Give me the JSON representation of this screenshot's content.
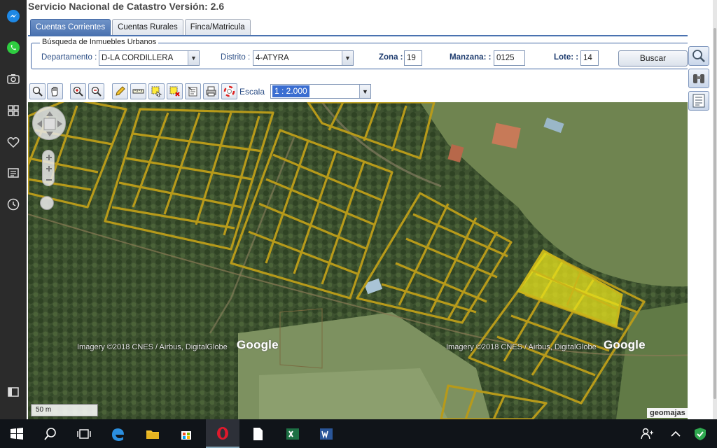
{
  "app": {
    "title": "Servicio Nacional de Catastro Versión: 2.6"
  },
  "tabs": [
    {
      "label": "Cuentas Corrientes",
      "active": true
    },
    {
      "label": "Cuentas Rurales",
      "active": false
    },
    {
      "label": "Finca/Matricula",
      "active": false
    }
  ],
  "search": {
    "legend": "Búsqueda de Inmuebles Urbanos",
    "departamento_label": "Departamento :",
    "departamento_value": "D-LA CORDILLERA",
    "distrito_label": "Distrito :",
    "distrito_value": "4-ATYRA",
    "zona_label": "Zona :",
    "zona_value": "19",
    "manzana_label": "Manzana: :",
    "manzana_value": "0125",
    "lote_label": "Lote: :",
    "lote_value": "14",
    "buscar_label": "Buscar"
  },
  "toolbar": {
    "scale_label": "Escala",
    "scale_value": "1 : 2.000"
  },
  "map": {
    "attribution_left": "Imagery ©2018 CNES / Airbus, DigitalGlobe",
    "attribution_right": "Imagery ©2018 CNES / Airbus, DigitalGlobe",
    "google_left": "Google",
    "google_right": "Google",
    "scale_bar": "50 m",
    "brand": "geomajas",
    "parcel_color": "#b79a1a",
    "selected_color": "#e7e21c"
  },
  "dock_icons": [
    "messenger-icon",
    "whatsapp-icon",
    "camera-icon",
    "apps-icon",
    "heart-icon",
    "news-icon",
    "clock-icon",
    "sidebar-toggle-icon"
  ],
  "taskbar_icons": [
    "windows-start-icon",
    "search-icon",
    "task-view-icon",
    "edge-icon",
    "file-explorer-icon",
    "store-icon",
    "opera-icon",
    "notepad-icon",
    "excel-icon",
    "word-icon"
  ],
  "tray_icons": [
    "people-icon",
    "chevron-up-icon",
    "security-shield-icon"
  ],
  "colors": {
    "accent": "#4a72b0",
    "label": "#2d4f86",
    "taskbar": "#101419",
    "dock": "#2b2b2b"
  }
}
